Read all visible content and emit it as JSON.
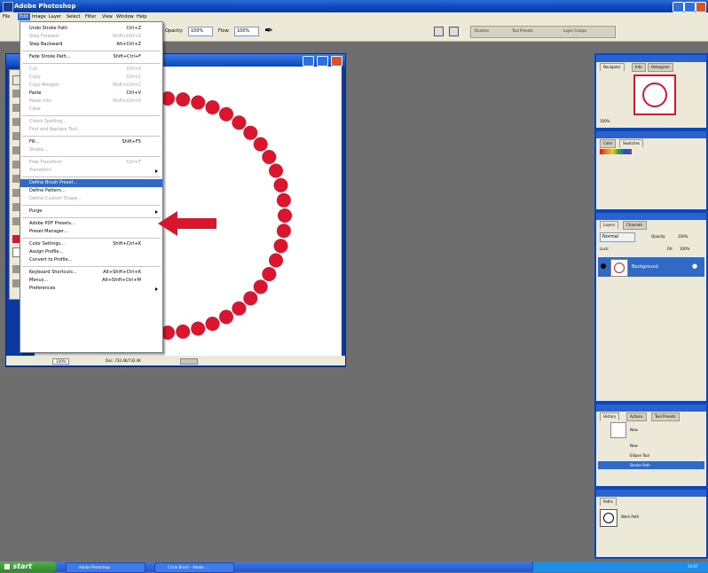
{
  "app": {
    "title": "Adobe Photoshop"
  },
  "menubar": {
    "items": [
      "File",
      "Edit",
      "Image",
      "Layer",
      "Select",
      "Filter",
      "View",
      "Window",
      "Help"
    ]
  },
  "options_bar": {
    "opacity_label": "Opacity:",
    "opacity_value": "100%",
    "flow_label": "Flow:",
    "flow_value": "100%",
    "tabs": [
      "Brushes",
      "Tool Presets",
      "Layer Comps"
    ]
  },
  "edit_menu": {
    "groups": [
      [
        {
          "label": "Undo Stroke Path",
          "shortcut": "Ctrl+Z",
          "disabled": false
        },
        {
          "label": "Step Forward",
          "shortcut": "Shift+Ctrl+Z",
          "disabled": true
        },
        {
          "label": "Step Backward",
          "shortcut": "Alt+Ctrl+Z",
          "disabled": false
        }
      ],
      [
        {
          "label": "Fade Stroke Path...",
          "shortcut": "Shift+Ctrl+F",
          "disabled": false
        }
      ],
      [
        {
          "label": "Cut",
          "shortcut": "Ctrl+X",
          "disabled": true
        },
        {
          "label": "Copy",
          "shortcut": "Ctrl+C",
          "disabled": true
        },
        {
          "label": "Copy Merged",
          "shortcut": "Shift+Ctrl+C",
          "disabled": true
        },
        {
          "label": "Paste",
          "shortcut": "Ctrl+V",
          "disabled": false
        },
        {
          "label": "Paste Into",
          "shortcut": "Shift+Ctrl+V",
          "disabled": true
        },
        {
          "label": "Clear",
          "shortcut": "",
          "disabled": true
        }
      ],
      [
        {
          "label": "Check Spelling...",
          "shortcut": "",
          "disabled": true
        },
        {
          "label": "Find and Replace Text...",
          "shortcut": "",
          "disabled": true
        }
      ],
      [
        {
          "label": "Fill...",
          "shortcut": "Shift+F5",
          "disabled": false
        },
        {
          "label": "Stroke...",
          "shortcut": "",
          "disabled": true
        }
      ],
      [
        {
          "label": "Free Transform",
          "shortcut": "Ctrl+T",
          "disabled": true
        },
        {
          "label": "Transform",
          "shortcut": "",
          "disabled": true,
          "submenu": true
        }
      ],
      [
        {
          "label": "Define Brush Preset...",
          "shortcut": "",
          "disabled": false,
          "highlighted": true
        },
        {
          "label": "Define Pattern...",
          "shortcut": "",
          "disabled": false
        },
        {
          "label": "Define Custom Shape...",
          "shortcut": "",
          "disabled": true
        }
      ],
      [
        {
          "label": "Purge",
          "shortcut": "",
          "disabled": false,
          "submenu": true
        }
      ],
      [
        {
          "label": "Adobe PDF Presets...",
          "shortcut": "",
          "disabled": false
        },
        {
          "label": "Preset Manager...",
          "shortcut": "",
          "disabled": false
        }
      ],
      [
        {
          "label": "Color Settings...",
          "shortcut": "Shift+Ctrl+K",
          "disabled": false
        },
        {
          "label": "Assign Profile...",
          "shortcut": "",
          "disabled": false
        },
        {
          "label": "Convert to Profile...",
          "shortcut": "",
          "disabled": false
        }
      ],
      [
        {
          "label": "Keyboard Shortcuts...",
          "shortcut": "Alt+Shift+Ctrl+K",
          "disabled": false
        },
        {
          "label": "Menus...",
          "shortcut": "Alt+Shift+Ctrl+M",
          "disabled": false
        },
        {
          "label": "Preferences",
          "shortcut": "",
          "disabled": false,
          "submenu": true
        }
      ]
    ]
  },
  "document": {
    "zoom": "100%",
    "doc_size": "Doc: 732.4K/732.4K"
  },
  "palettes": {
    "navigator": {
      "tabs": [
        "Navigator",
        "Info",
        "Histogram"
      ],
      "zoom": "100%"
    },
    "color": {
      "tabs": [
        "Color",
        "Swatches"
      ]
    },
    "layers": {
      "tabs": [
        "Layers",
        "Channels"
      ],
      "blend_mode": "Normal",
      "opacity_label": "Opacity:",
      "opacity_value": "100%",
      "lock_label": "Lock:",
      "fill_label": "Fill:",
      "fill_value": "100%",
      "layer_name": "Background"
    },
    "history": {
      "tabs": [
        "History",
        "Actions",
        "Tool Presets"
      ],
      "snapshot": "New",
      "steps": [
        "New",
        "Ellipse Tool",
        "Stroke Path"
      ]
    },
    "paths": {
      "tabs": [
        "Paths"
      ],
      "path_name": "Work Path"
    }
  },
  "taskbar": {
    "start_label": "start",
    "tasks": [
      "Adobe Photoshop",
      "Circle Brush - Adobe ..."
    ],
    "clock": "14:07"
  },
  "colors": {
    "accent_red": "#d9162e",
    "highlight_blue": "#316ac5",
    "xp_blue": "#0d46b8"
  }
}
